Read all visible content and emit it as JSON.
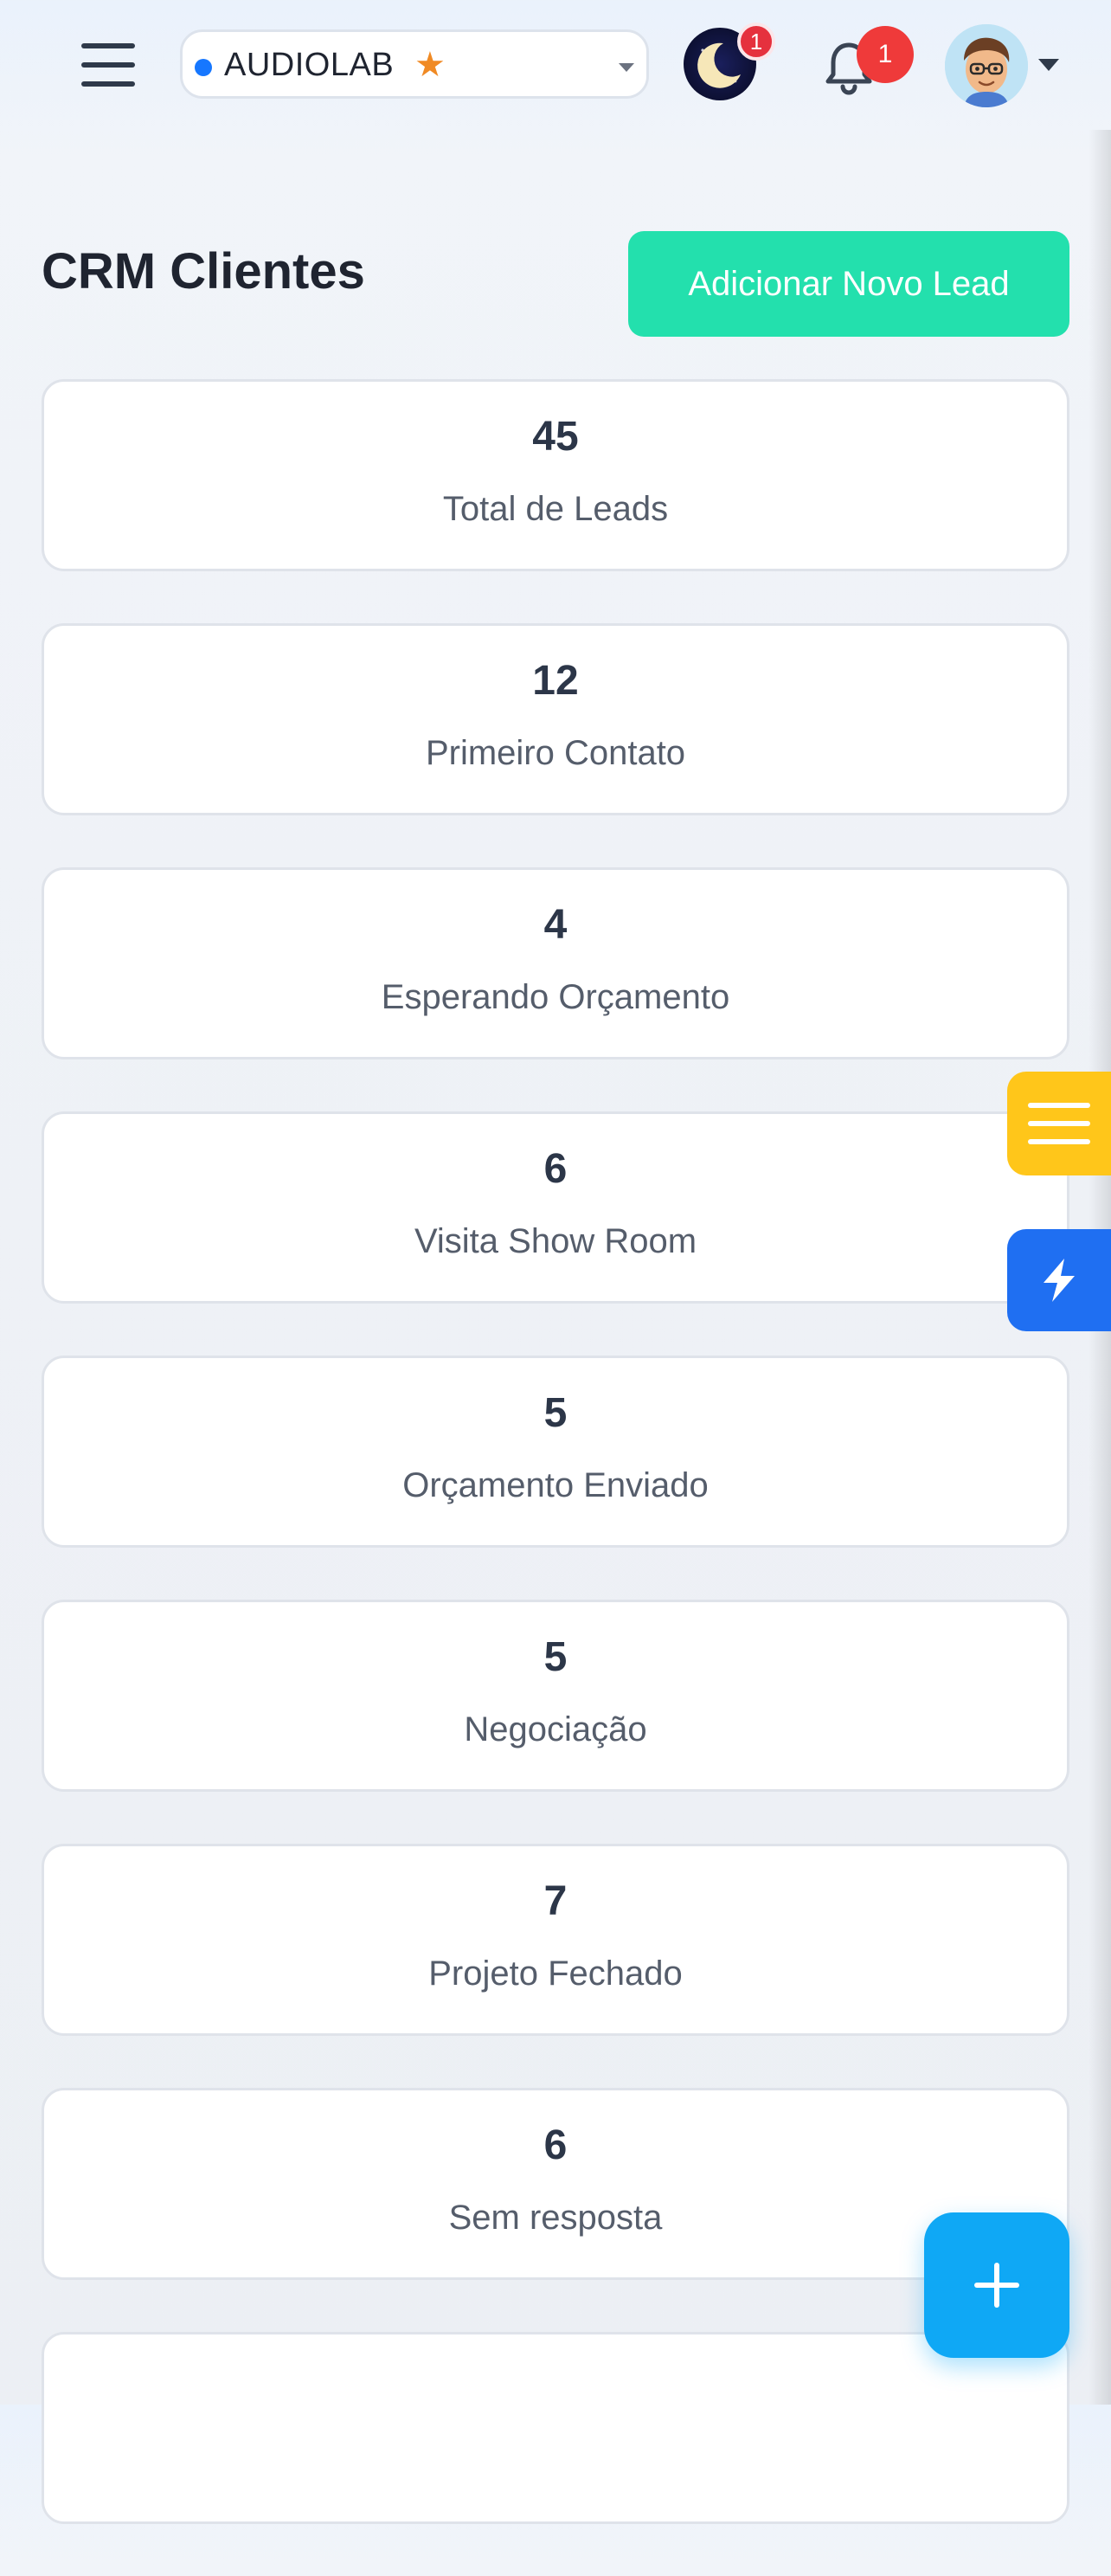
{
  "header": {
    "company": "AUDIOLAB",
    "company_star": "★",
    "theme_badge": "1",
    "notification_badge": "1"
  },
  "page": {
    "title": "CRM Clientes",
    "add_button_label": "Adicionar Novo Lead"
  },
  "stats": [
    {
      "value": "45",
      "label": "Total de Leads"
    },
    {
      "value": "12",
      "label": "Primeiro Contato"
    },
    {
      "value": "4",
      "label": "Esperando Orçamento"
    },
    {
      "value": "6",
      "label": "Visita Show Room"
    },
    {
      "value": "5",
      "label": "Orçamento Enviado"
    },
    {
      "value": "5",
      "label": "Negociação"
    },
    {
      "value": "7",
      "label": "Projeto Fechado"
    },
    {
      "value": "6",
      "label": "Sem resposta"
    },
    {
      "value": "",
      "label": ""
    }
  ],
  "icons": {
    "menu": "hamburger-icon",
    "theme": "moon-icon",
    "notifications": "bell-icon",
    "side_menu": "menu-lines-icon",
    "side_actions": "lightning-bolt-icon",
    "fab": "plus-icon"
  },
  "colors": {
    "accent_green": "#23e0ad",
    "fab_blue": "#0fa8f5",
    "side_yellow": "#ffc61a",
    "side_blue": "#1f6ff2",
    "badge_red": "#ef3a3a"
  }
}
